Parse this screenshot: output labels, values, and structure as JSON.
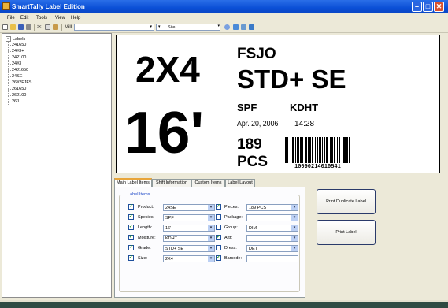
{
  "app": {
    "title": "SmartTally Label Edition"
  },
  "menu": [
    "File",
    "Edit",
    "Tools",
    "View",
    "Help"
  ],
  "toolbar": {
    "mill_label": "Mill",
    "mill_value": "",
    "site_label": "Site",
    "site_value": ""
  },
  "tree": {
    "root": "Labels",
    "items": [
      "241650",
      "24#3+",
      "242100",
      "24#3",
      "24J1650",
      "24SE",
      "26#2FJFS",
      "261650",
      "262100",
      "26J"
    ]
  },
  "label_preview": {
    "dimension": "2X4",
    "length": "16'",
    "mill_code": "FSJO",
    "grade": "STD+ SE",
    "species": "SPF",
    "moisture": "KDHT",
    "date": "Apr. 20, 2006",
    "time": "14:28",
    "pieces": "189",
    "pieces_unit": "PCS",
    "barcode_number": "10090214010541"
  },
  "tabs": [
    "Main Label Items",
    "Shift Information",
    "Custom Items",
    "Label Layout"
  ],
  "active_tab": "Main Label Items",
  "group_title": "Label Items",
  "left_fields": [
    {
      "label": "Product:",
      "checked": true,
      "value": "24SE"
    },
    {
      "label": "Species:",
      "checked": true,
      "value": "SPF"
    },
    {
      "label": "Length:",
      "checked": true,
      "value": "16'"
    },
    {
      "label": "Moisture:",
      "checked": true,
      "value": "KDHT"
    },
    {
      "label": "Grade:",
      "checked": true,
      "value": "STD+ SE"
    },
    {
      "label": "Size:",
      "checked": true,
      "value": "2X4"
    }
  ],
  "right_fields": [
    {
      "label": "Pieces:",
      "checked": true,
      "value": "189 PCS",
      "kind": "combo"
    },
    {
      "label": "Package:",
      "checked": false,
      "value": "",
      "kind": "combo"
    },
    {
      "label": "Group:",
      "checked": false,
      "value": "DIM",
      "kind": "combo"
    },
    {
      "label": "Attr:",
      "checked": true,
      "value": "",
      "kind": "combo"
    },
    {
      "label": "Dress:",
      "checked": false,
      "value": "DET",
      "kind": "combo"
    },
    {
      "label": "Barcode:",
      "checked": true,
      "value": "",
      "kind": "text"
    }
  ],
  "buttons": {
    "print_duplicate": "Print Duplicate Label",
    "print_label": "Print Label"
  },
  "colors": {
    "titlebar": "#0a4fd6",
    "window": "#ece9d8",
    "desktop": "#2f4b43",
    "accent_tab": "#e8a53a"
  }
}
